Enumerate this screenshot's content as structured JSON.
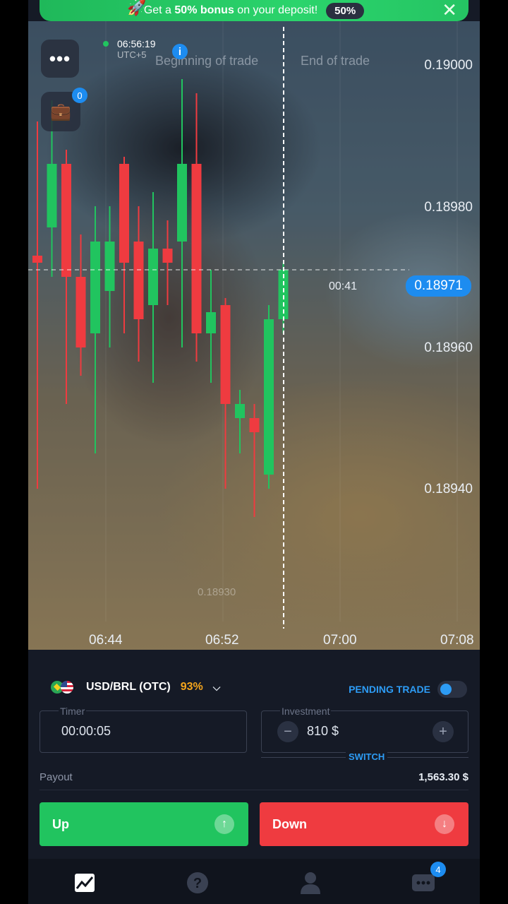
{
  "promo": {
    "text_before": "Get a ",
    "text_bold": "50% bonus",
    "text_after": " on your deposit!",
    "badge": "50%",
    "close_icon": "close-icon",
    "rocket_icon": "rocket-icon"
  },
  "chart": {
    "clock_time": "06:56:19",
    "clock_tz": "UTC+5",
    "info_icon": "i",
    "beginning_label": "Beginning of trade",
    "end_label": "End of trade",
    "countdown": "00:41",
    "current_price": "0.18971",
    "faint_price": "0.18930",
    "case_badge": "0",
    "price_labels": [
      "0.19000",
      "0.18980",
      "0.18960",
      "0.18940"
    ],
    "time_labels": [
      "06:44",
      "06:52",
      "07:00",
      "07:08"
    ]
  },
  "chart_data": {
    "type": "candlestick",
    "y_axis_ticks": [
      "0.19000",
      "0.18980",
      "0.18960",
      "0.18940"
    ],
    "x_axis_ticks": [
      "06:44",
      "06:52",
      "07:00",
      "07:08"
    ],
    "current_price": 0.18971,
    "ylim": [
      0.1893,
      0.19
    ],
    "up_color": "#21c45f",
    "down_color": "#ef3b40",
    "candles": [
      {
        "x": 0,
        "open": 0.18973,
        "close": 0.18972,
        "high": 0.18992,
        "low": 0.1894,
        "dir": "down"
      },
      {
        "x": 1,
        "open": 0.18977,
        "close": 0.18986,
        "high": 0.18995,
        "low": 0.1897,
        "dir": "up"
      },
      {
        "x": 2,
        "open": 0.18986,
        "close": 0.1897,
        "high": 0.18988,
        "low": 0.18952,
        "dir": "down"
      },
      {
        "x": 3,
        "open": 0.1897,
        "close": 0.1896,
        "high": 0.18976,
        "low": 0.18956,
        "dir": "down"
      },
      {
        "x": 4,
        "open": 0.18962,
        "close": 0.18975,
        "high": 0.1898,
        "low": 0.18945,
        "dir": "up"
      },
      {
        "x": 5,
        "open": 0.18968,
        "close": 0.18975,
        "high": 0.1898,
        "low": 0.1896,
        "dir": "up"
      },
      {
        "x": 6,
        "open": 0.18986,
        "close": 0.18972,
        "high": 0.18987,
        "low": 0.18962,
        "dir": "down"
      },
      {
        "x": 7,
        "open": 0.18975,
        "close": 0.18964,
        "high": 0.1898,
        "low": 0.18958,
        "dir": "down"
      },
      {
        "x": 8,
        "open": 0.18966,
        "close": 0.18974,
        "high": 0.18982,
        "low": 0.18955,
        "dir": "up"
      },
      {
        "x": 9,
        "open": 0.18974,
        "close": 0.18972,
        "high": 0.18978,
        "low": 0.18966,
        "dir": "down"
      },
      {
        "x": 10,
        "open": 0.18975,
        "close": 0.18986,
        "high": 0.18998,
        "low": 0.1896,
        "dir": "up"
      },
      {
        "x": 11,
        "open": 0.18986,
        "close": 0.18962,
        "high": 0.18996,
        "low": 0.18958,
        "dir": "down"
      },
      {
        "x": 12,
        "open": 0.18962,
        "close": 0.18965,
        "high": 0.18971,
        "low": 0.18955,
        "dir": "up"
      },
      {
        "x": 13,
        "open": 0.18966,
        "close": 0.18952,
        "high": 0.18967,
        "low": 0.1894,
        "dir": "down"
      },
      {
        "x": 14,
        "open": 0.18952,
        "close": 0.1895,
        "high": 0.18954,
        "low": 0.18945,
        "dir": "up"
      },
      {
        "x": 15,
        "open": 0.1895,
        "close": 0.18948,
        "high": 0.18952,
        "low": 0.18936,
        "dir": "down"
      },
      {
        "x": 16,
        "open": 0.18942,
        "close": 0.18964,
        "high": 0.18966,
        "low": 0.1894,
        "dir": "up"
      },
      {
        "x": 17,
        "open": 0.18964,
        "close": 0.18971,
        "high": 0.18972,
        "low": 0.18962,
        "dir": "up"
      }
    ]
  },
  "panel": {
    "asset": "USD/BRL (OTC)",
    "payout_pct": "93%",
    "pending_label": "PENDING TRADE",
    "timer_label": "Timer",
    "timer_value": "00:00:05",
    "investment_label": "Investment",
    "investment_value": "810 $",
    "switch_label": "SWITCH",
    "payout_label": "Payout",
    "payout_value": "1,563.30 $",
    "up_label": "Up",
    "down_label": "Down"
  },
  "nav": {
    "badge": "4",
    "items": [
      "chart-icon",
      "help-icon",
      "profile-icon",
      "more-icon"
    ]
  },
  "colors": {
    "accent_blue": "#1d8cf0",
    "green": "#21c45f",
    "red": "#ef3b40",
    "orange": "#f4a51c",
    "panel_bg": "#151a26"
  }
}
